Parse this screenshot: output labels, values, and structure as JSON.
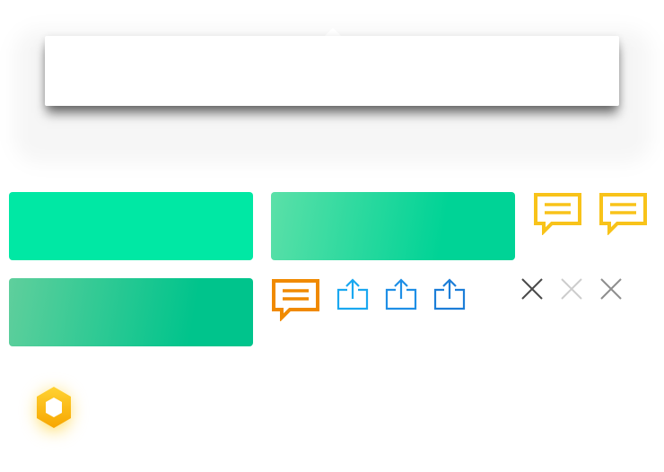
{
  "colors": {
    "primary_green": "#00e8a4",
    "gradient_light": "#5be0a8",
    "gradient_dark": "#00d396",
    "gradient_muted": "#5fcf9c",
    "gradient_muted_dark": "#00c48c",
    "chat_yellow": "#f8c31a",
    "chat_orange": "#f08a00",
    "share_light_blue": "#1aa8f0",
    "share_blue": "#1f8fe6",
    "share_dark_blue": "#1c7ed8",
    "close_dark": "#4a4a4a",
    "close_light": "#cccccc",
    "close_mid": "#8e8e8e",
    "logo_yellow": "#ffd232",
    "logo_orange": "#f7a600"
  },
  "popover": {
    "content": ""
  },
  "buttons": [
    {
      "name": "primary-button",
      "style": "solid"
    },
    {
      "name": "primary-button-gradient",
      "style": "gradient"
    },
    {
      "name": "primary-button-gradient-muted",
      "style": "gradient-muted"
    }
  ],
  "icons": [
    {
      "name": "comment-icon",
      "color": "chat_yellow"
    },
    {
      "name": "comment-icon",
      "color": "chat_yellow"
    },
    {
      "name": "comment-icon",
      "color": "chat_orange"
    },
    {
      "name": "share-icon",
      "color": "share_light_blue"
    },
    {
      "name": "share-icon",
      "color": "share_blue"
    },
    {
      "name": "share-icon",
      "color": "share_dark_blue"
    },
    {
      "name": "close-icon",
      "color": "close_dark"
    },
    {
      "name": "close-icon",
      "color": "close_light"
    },
    {
      "name": "close-icon",
      "color": "close_mid"
    },
    {
      "name": "hexagon-logo-icon",
      "color": "logo_orange"
    }
  ]
}
